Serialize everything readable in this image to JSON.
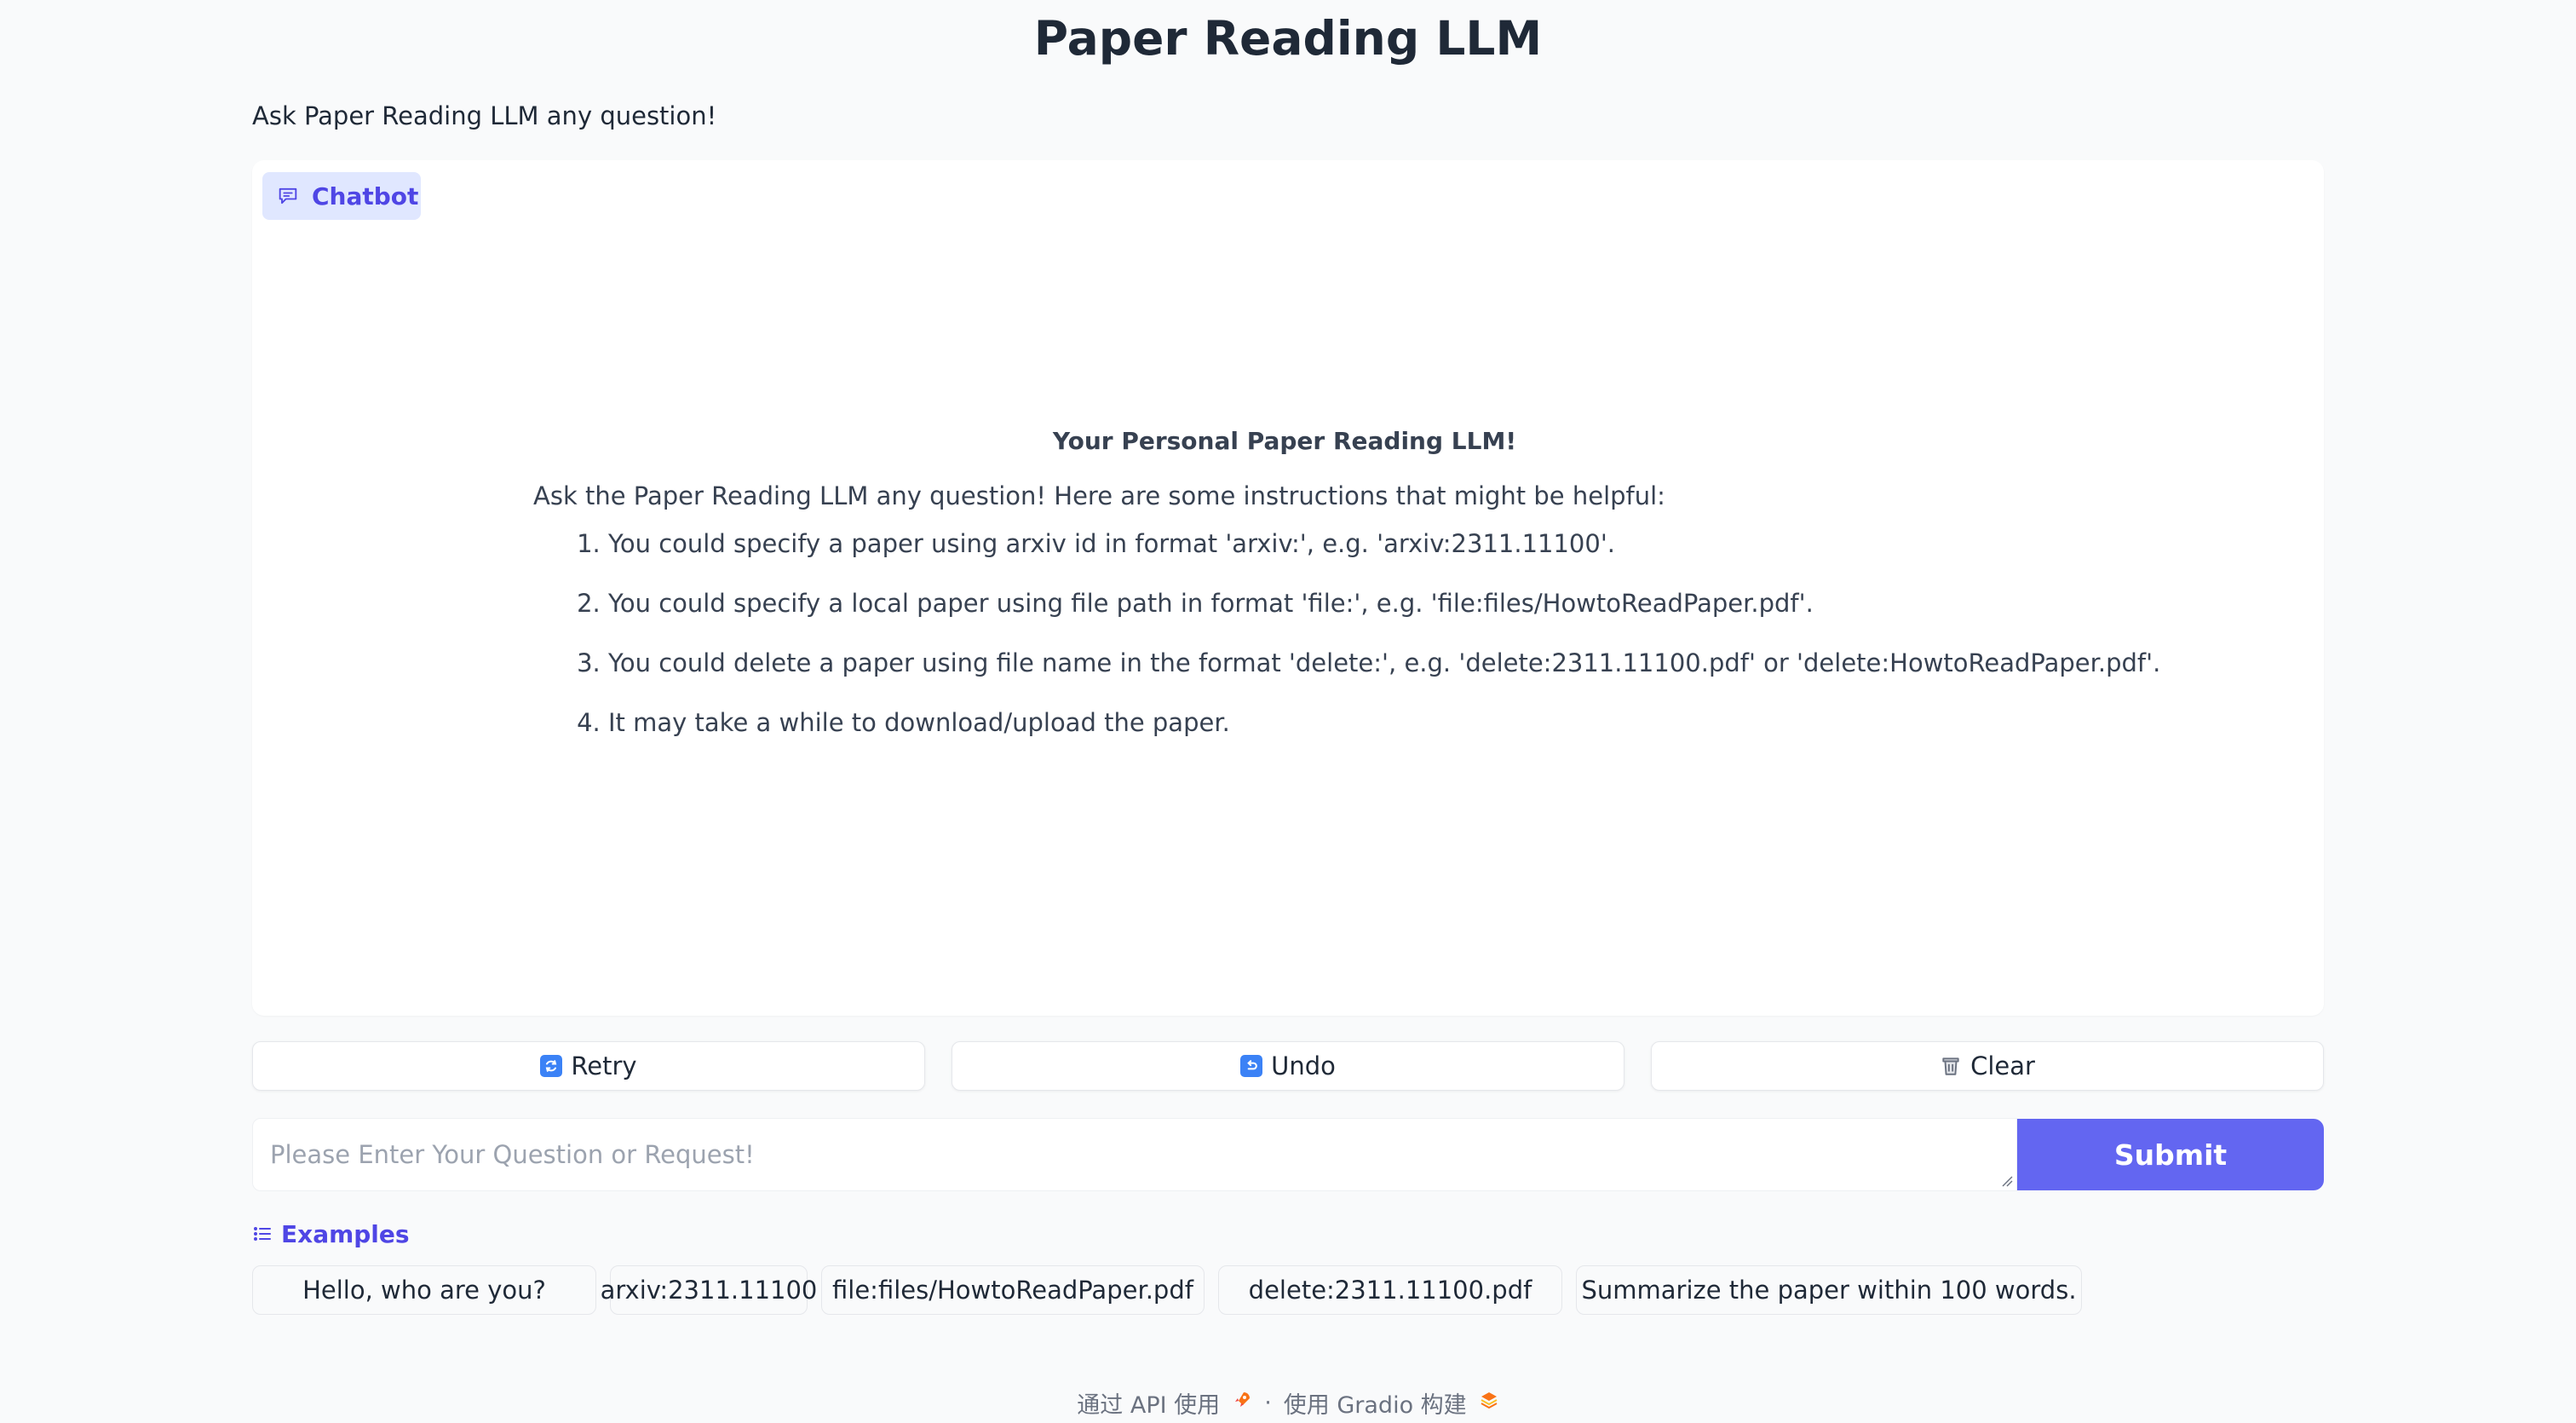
{
  "app": {
    "title": "Paper Reading LLM",
    "description": "Ask Paper Reading LLM any question!"
  },
  "chatbot": {
    "label": "Chatbot",
    "welcome_title": "Your Personal Paper Reading LLM!",
    "welcome_intro": "Ask the Paper Reading LLM any question! Here are some instructions that might be helpful:",
    "instructions": [
      "You could specify a paper using arxiv id in format 'arxiv:', e.g. 'arxiv:2311.11100'.",
      "You could specify a local paper using file path in format 'file:', e.g. 'file:files/HowtoReadPaper.pdf'.",
      "You could delete a paper using file name in the format 'delete:', e.g. 'delete:2311.11100.pdf' or 'delete:HowtoReadPaper.pdf'.",
      "It may take a while to download/upload the paper."
    ]
  },
  "controls": {
    "retry_label": "Retry",
    "undo_label": "Undo",
    "clear_label": "Clear"
  },
  "input": {
    "placeholder": "Please Enter Your Question or Request!",
    "value": "",
    "submit_label": "Submit"
  },
  "examples": {
    "label": "Examples",
    "items": [
      "Hello, who are you?",
      "arxiv:2311.11100",
      "file:files/HowtoReadPaper.pdf",
      "delete:2311.11100.pdf",
      "Summarize the paper within 100 words."
    ]
  },
  "footer": {
    "api_text": "通过 API 使用",
    "separator": "·",
    "built_with_text": "使用 Gradio 构建"
  },
  "colors": {
    "accent": "#6366f1",
    "accent_text": "#4f46e5",
    "label_bg": "#e0e7ff",
    "page_bg": "#f9fafb"
  },
  "icons": {
    "chatbot": "chat-bubble-icon",
    "retry": "retry-emoji-icon",
    "undo": "undo-emoji-icon",
    "clear": "wastebasket-icon",
    "examples": "list-icon",
    "api": "rocket-icon",
    "gradio": "gradio-logo-icon"
  }
}
